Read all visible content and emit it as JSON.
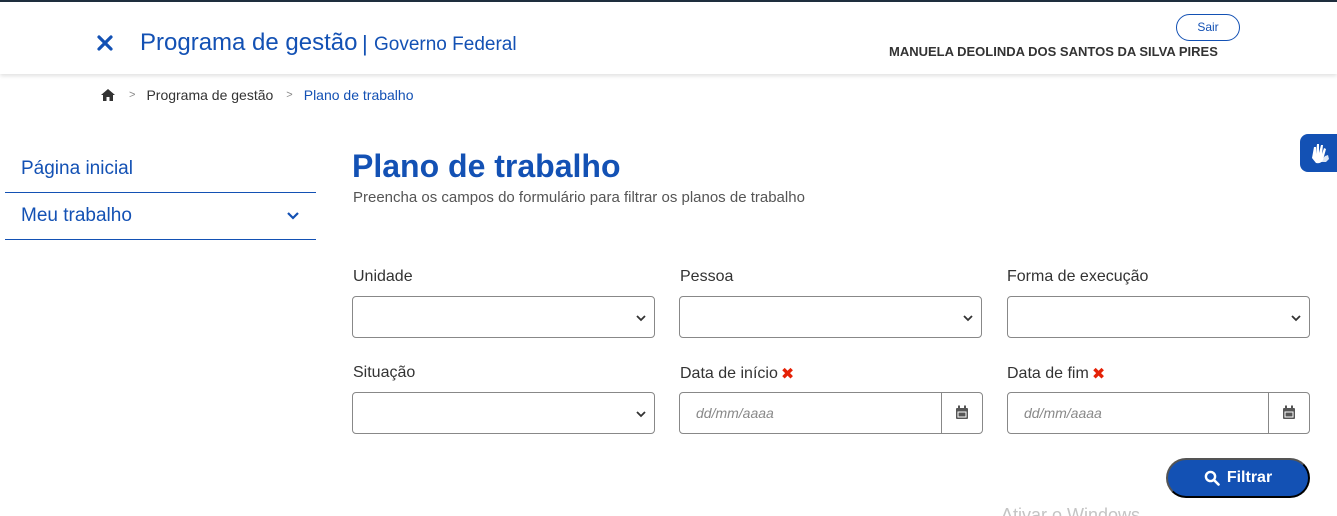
{
  "colors": {
    "brand_blue": "#1351b4",
    "required_red": "#e52207"
  },
  "header": {
    "close_icon": "close-icon",
    "title": "Programa de gestão",
    "separator": "|",
    "subtitle": "Governo Federal",
    "logout_label": "Sair",
    "user_name": "MANUELA DEOLINDA DOS SANTOS DA SILVA PIRES"
  },
  "breadcrumb": {
    "home_icon": "home-icon",
    "separator": ">",
    "items": [
      "Programa de gestão",
      "Plano de trabalho"
    ]
  },
  "sidebar": {
    "items": [
      {
        "label": "Página inicial"
      },
      {
        "label": "Meu trabalho",
        "icon": "chevron-down-icon"
      }
    ]
  },
  "main": {
    "title": "Plano de trabalho",
    "description": "Preencha os campos do formulário para filtrar os planos de trabalho",
    "fields": {
      "unidade": {
        "label": "Unidade",
        "value": ""
      },
      "pessoa": {
        "label": "Pessoa",
        "value": ""
      },
      "forma_execucao": {
        "label": "Forma de execução",
        "value": ""
      },
      "situacao": {
        "label": "Situação",
        "value": ""
      },
      "data_inicio": {
        "label": "Data de início",
        "placeholder": "dd/mm/aaaa",
        "required_mark": "✖"
      },
      "data_fim": {
        "label": "Data de fim",
        "placeholder": "dd/mm/aaaa",
        "required_mark": "✖"
      }
    },
    "filter_button": {
      "label": "Filtrar",
      "icon": "search-icon"
    }
  },
  "accessibility_widget": {
    "icon": "sign-language-icon"
  },
  "watermark": "Ativar o Windows"
}
